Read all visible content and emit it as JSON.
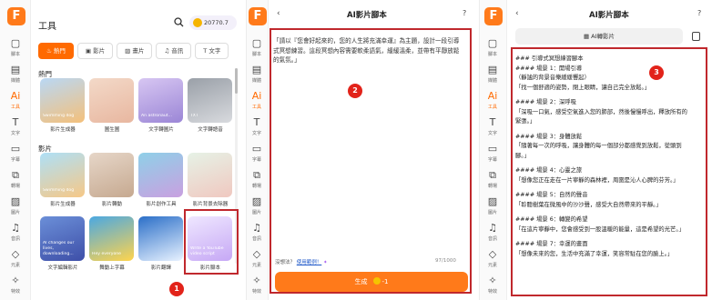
{
  "rail": {
    "logo": "F",
    "items": [
      {
        "label": "腳本",
        "icon": "window-icon"
      },
      {
        "label": "媒體",
        "icon": "media-icon"
      },
      {
        "label": "工具",
        "icon": "ai-icon",
        "active": true
      },
      {
        "label": "文字",
        "icon": "text-icon"
      },
      {
        "label": "字幕",
        "icon": "subtitle-icon"
      },
      {
        "label": "轉場",
        "icon": "transition-icon"
      },
      {
        "label": "圖片",
        "icon": "image-icon"
      },
      {
        "label": "音訊",
        "icon": "music-icon"
      },
      {
        "label": "元素",
        "icon": "element-icon"
      },
      {
        "label": "特效",
        "icon": "effect-icon"
      }
    ]
  },
  "tools": {
    "title": "工具",
    "coins": "20770.7",
    "tabs": [
      "熱門",
      "影片",
      "畫片",
      "音訊",
      "文字"
    ],
    "section_hot": "熱門",
    "section_video": "影片",
    "hot_cards": [
      {
        "label": "影片生成器",
        "art": "Swimming dog"
      },
      {
        "label": "圖生圖",
        "art": ""
      },
      {
        "label": "文字轉圖片",
        "art": "An astronaut..."
      },
      {
        "label": "文字轉語音",
        "art": "TXT"
      }
    ],
    "video_cards": [
      {
        "label": "影片生成器",
        "art": "Swimming dog"
      },
      {
        "label": "影片轉動",
        "art": ""
      },
      {
        "label": "影片創作工具",
        "art": ""
      },
      {
        "label": "影片背景去除器",
        "art": ""
      }
    ],
    "row3_cards": [
      {
        "label": "文字編輯影片",
        "art": "AI changes our lives, downloading..."
      },
      {
        "label": "舞動上字幕",
        "art": "Hey everyone"
      },
      {
        "label": "影片翻譯",
        "art": ""
      },
      {
        "label": "影片腳本",
        "art": "Write a YouTube video script"
      }
    ]
  },
  "panel2": {
    "title": "AI影片腳本",
    "back": "‹",
    "help": "?",
    "prompt": "「請以『您會好起來的，您的人生將充滿幸運』為主題，設計一段引導式冥想練習。這段冥想內容需要軟柔語氣，緩緩溫柔，並帶有平靜放鬆的氣氛。」",
    "hint": "沒想法？",
    "hint_link": "使用範例！",
    "counter": "97/1000",
    "generate": "生成",
    "cost": "-1"
  },
  "panel3": {
    "title": "AI影片腳本",
    "back": "‹",
    "help": "?",
    "regen": "AI轉影片",
    "lines": [
      "### 引導式冥想練習腳本",
      "#### 場景 1：開場引導",
      "（靜謐的背景音樂緩緩響起）",
      "「找一個舒適的姿勢，閉上眼睛，讓自己完全放鬆。」",
      "#### 場景 2：深呼吸",
      "「深吸一口氣，感受空氣進入您的肺部，然後慢慢呼出，釋放所有的",
      "緊張。」",
      "#### 場景 3：身體放鬆",
      "「隨著每一次的呼吸，讓身體的每一個部分都感覺到放鬆，從頭到",
      "腳。」",
      "#### 場景 4：心靈之旅",
      "「想像您正在走在一片寧靜的森林裡，周圍是沁人心脾的芬芳。」",
      "#### 場景 5：自然的聲音",
      "「聆聽樹葉在微風中的沙沙聲，感受大自然帶來的平靜。」",
      "#### 場景 6：轉變的希望",
      "「在這片寧靜中，您會感受到一股溫暖的能量，這是希望的光芒。」",
      "#### 場景 7：幸運的畫面",
      "「想像未來的您，生活中充滿了幸運，笑容常駐在您的臉上。」"
    ]
  },
  "badges": [
    "1",
    "2",
    "3"
  ],
  "colors": {
    "accent": "#ff7a1a",
    "highlight": "#c0282d",
    "badge": "#e2231a"
  }
}
